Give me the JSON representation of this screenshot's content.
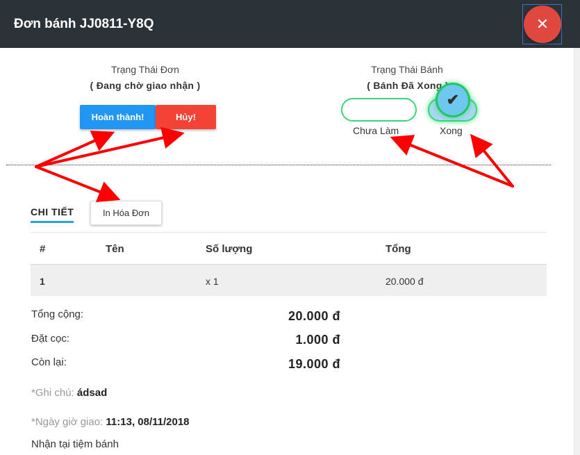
{
  "header": {
    "title": "Đơn bánh JJ0811-Y8Q",
    "close_symbol": "✕"
  },
  "order_status": {
    "label": "Trạng Thái Đơn",
    "value": "( Đang chờ giao nhận )",
    "complete_button": "Hoàn thành!",
    "cancel_button": "Hủy!"
  },
  "cake_status": {
    "label": "Trạng Thái Bánh",
    "value": "( Bánh Đã Xong )",
    "option_not_done": "Chưa Làm",
    "option_done": "Xong",
    "check_symbol": "✔"
  },
  "tabs": {
    "detail": "CHI TIẾT",
    "print_invoice": "In Hóa Đơn"
  },
  "table": {
    "headers": [
      "#",
      "Tên",
      "Số lượng",
      "Tổng"
    ],
    "rows": [
      {
        "index": "1",
        "name": "",
        "qty": "x 1",
        "total": "20.000 đ"
      }
    ]
  },
  "summary": {
    "total_label": "Tổng cộng:",
    "total_value": "20.000 đ",
    "deposit_label": "Đặt cọc:",
    "deposit_value": "1.000 đ",
    "remaining_label": "Còn lại:",
    "remaining_value": "19.000 đ"
  },
  "note": {
    "label": "*Ghi chú:",
    "value": "ádsad"
  },
  "delivery": {
    "label": "*Ngày giờ giao:",
    "value": "11:13, 08/11/2018"
  },
  "pickup": "Nhận tại tiệm bánh",
  "colors": {
    "header_bg": "#2b3238",
    "close_red": "#e0473f",
    "complete_blue": "#2196f3",
    "cancel_red": "#f44336",
    "toggle_green": "#37d67a",
    "tab_underline": "#29a3e0",
    "arrow_red": "#ff0000"
  },
  "icons": {
    "close": "close-icon",
    "check": "check-icon"
  }
}
